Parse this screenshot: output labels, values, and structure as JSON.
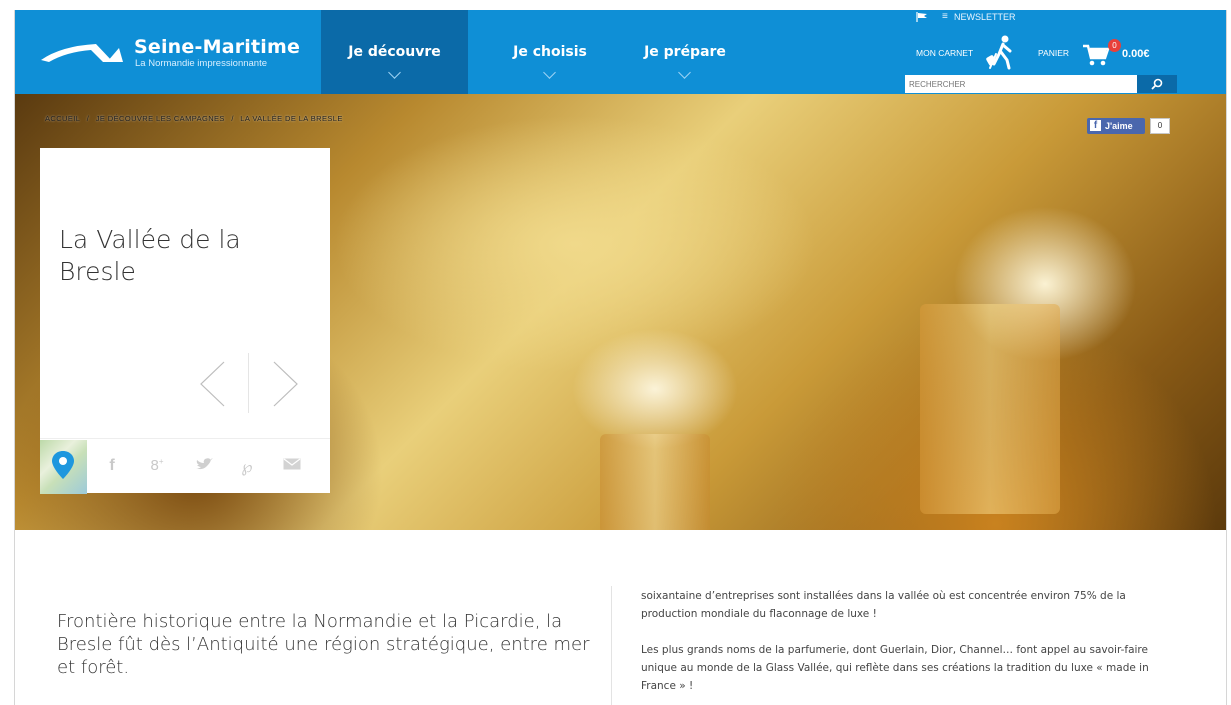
{
  "header": {
    "logo_title": "Seine-Maritime",
    "logo_subtitle": "La Normandie impressionnante",
    "nav": [
      {
        "label": "Je découvre",
        "active": true
      },
      {
        "label": "Je choisis",
        "active": false
      },
      {
        "label": "Je prépare",
        "active": false
      }
    ],
    "newsletter_label": "NEWSLETTER",
    "carnet_label": "MON CARNET",
    "panier_label": "PANIER",
    "cart_count": "0",
    "cart_total": "0.00€",
    "search_placeholder": "RECHERCHER"
  },
  "breadcrumb": [
    "ACCUEIL",
    "/",
    "JE DÉCOUVRE LES CAMPAGNES",
    "/",
    "LA VALLÉE DE LA BRESLE"
  ],
  "facebook": {
    "like_label": "J'aime",
    "like_count": "0"
  },
  "card": {
    "title": "La Vallée de la Bresle",
    "share_icons": [
      "facebook-icon",
      "google-plus-icon",
      "twitter-icon",
      "pinterest-icon",
      "mail-icon"
    ]
  },
  "content": {
    "lead": "Frontière historique entre la Normandie et la Picardie, la Bresle fût dès l’Antiquité une région stratégique, entre mer et forêt.",
    "para1": "soixantaine d’entreprises sont installées dans la vallée où est concentrée environ 75% de la production mondiale du flaconnage de luxe !",
    "para2": "Les plus grands noms de la parfumerie, dont Guerlain, Dior, Channel… font appel au savoir-faire unique au monde de la Glass Vallée, qui reflète dans ses créations la tradition du luxe « made in France » !"
  },
  "colors": {
    "header_blue": "#0f8fd6",
    "nav_active": "#0b6aa8",
    "cart_badge": "#e8403a",
    "facebook": "#4a67ad"
  }
}
